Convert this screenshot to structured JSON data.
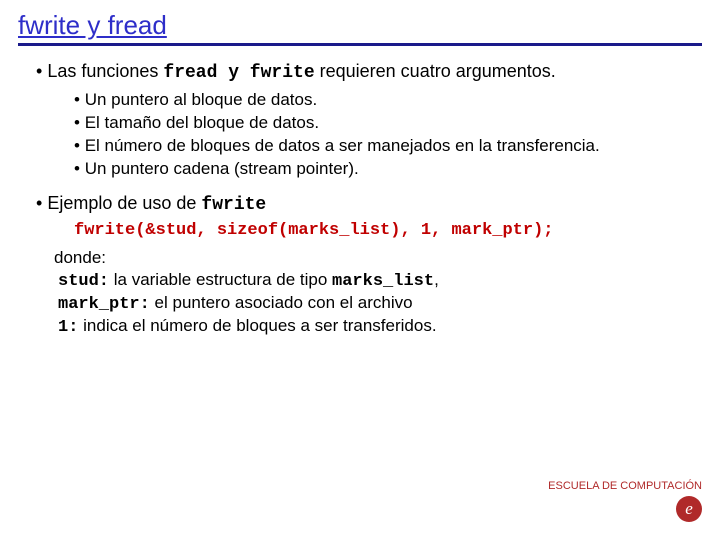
{
  "title": "fwrite y fread",
  "p1": {
    "pre": "Las funciones ",
    "code": "fread y fwrite",
    "post": " requieren cuatro argumentos."
  },
  "args": [
    "Un puntero al bloque de datos.",
    "El tamaño del bloque de datos.",
    "El número de bloques de datos a ser manejados en la transferencia.",
    "Un puntero cadena (stream pointer)."
  ],
  "p2": {
    "pre": "Ejemplo de uso de ",
    "code": "fwrite"
  },
  "codeline": "fwrite(&stud, sizeof(marks_list), 1, mark_ptr);",
  "donde_label": "donde:",
  "donde": [
    {
      "k": "stud:",
      "v": " la variable estructura de tipo ",
      "k2": "marks_list",
      "tail": ","
    },
    {
      "k": "mark_ptr:",
      "v": " el puntero asociado con el archivo",
      "k2": "",
      "tail": ""
    },
    {
      "k": "1:",
      "v": " indica el número de bloques a ser transferidos.",
      "k2": "",
      "tail": ""
    }
  ],
  "footer": "ESCUELA DE COMPUTACIÓN",
  "logo": "e"
}
